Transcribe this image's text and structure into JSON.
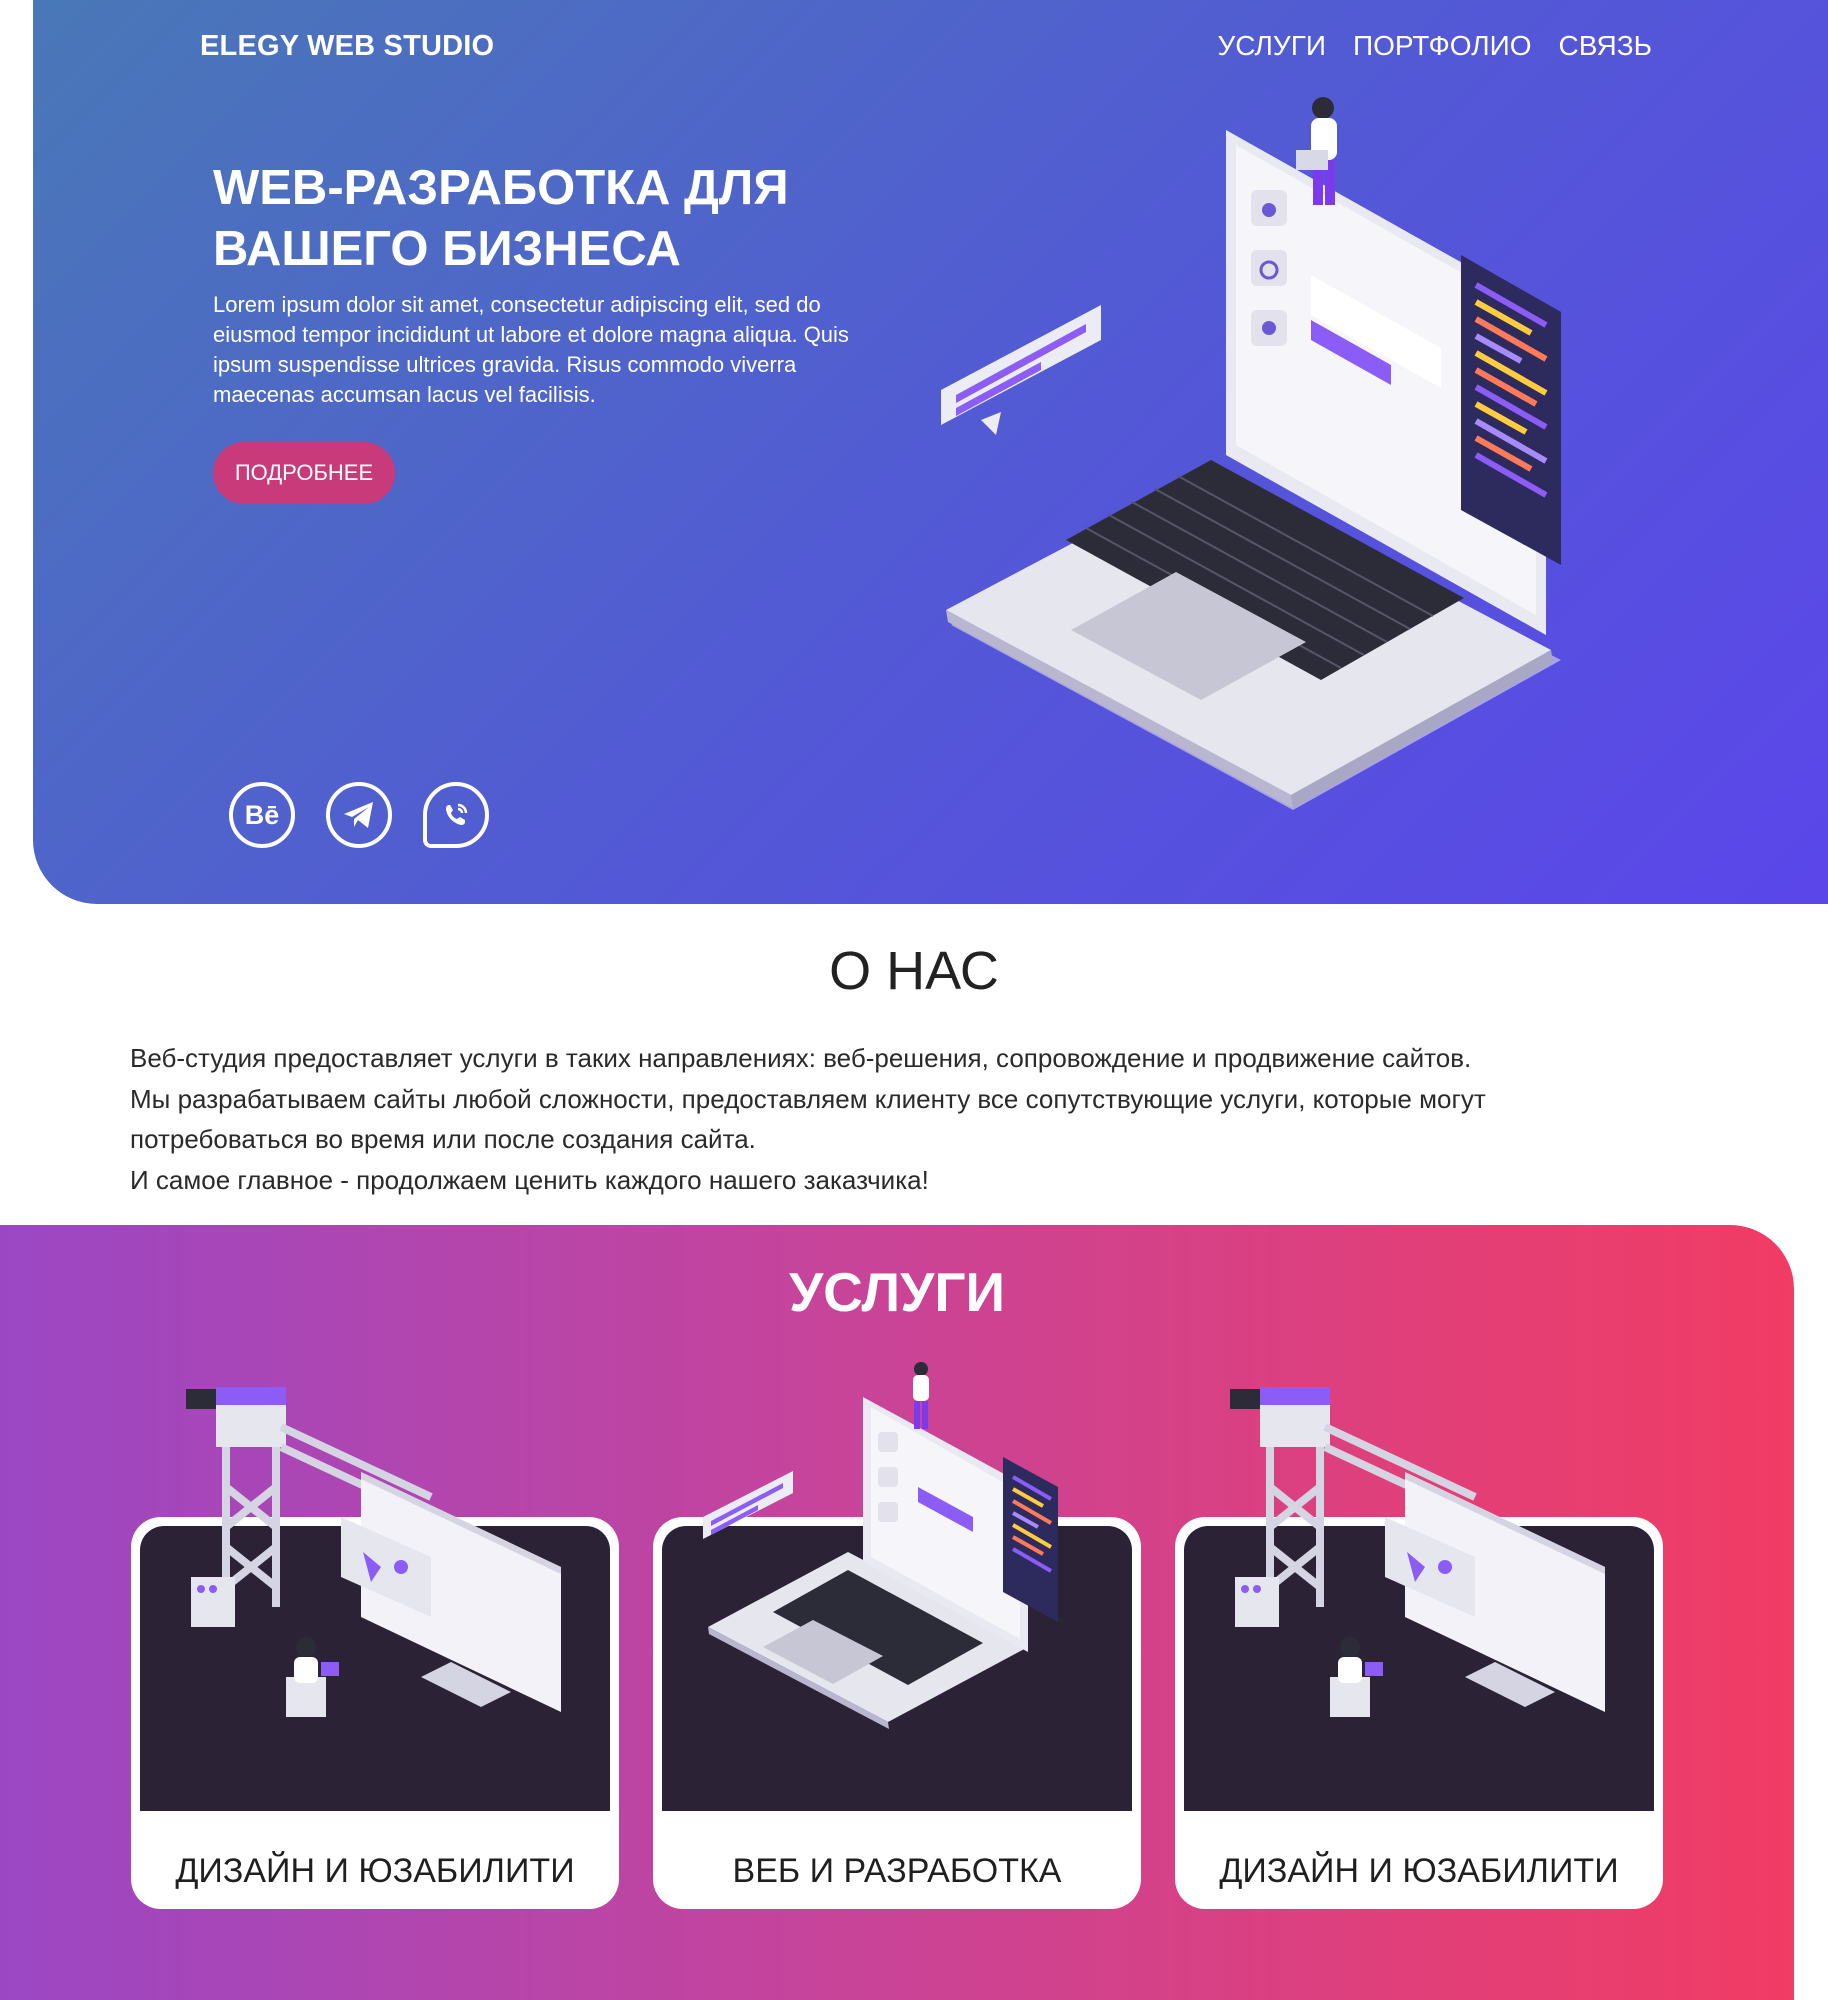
{
  "header": {
    "logo": "ELEGY WEB STUDIO",
    "nav": [
      "УСЛУГИ",
      "ПОРТФОЛИО",
      "СВЯЗЬ"
    ]
  },
  "hero": {
    "title": "WEB-РАЗРАБОТКА ДЛЯ ВАШЕГО БИЗНЕСА",
    "text": "Lorem ipsum dolor sit amet, consectetur adipiscing elit, sed do eiusmod tempor incididunt ut labore et dolore magna aliqua. Quis ipsum suspendisse ultrices gravida. Risus commodo viverra maecenas accumsan lacus vel facilisis.",
    "button": "ПОДРОБНЕЕ",
    "socials": [
      {
        "icon": "behance-icon",
        "text": "Bē"
      },
      {
        "icon": "telegram-icon"
      },
      {
        "icon": "viber-icon"
      }
    ]
  },
  "about": {
    "title": "О НАС",
    "paragraphs": [
      "Веб-студия предоставляет услуги в таких направлениях: веб-решения, сопровождение и продвижение сайтов.",
      "Мы разрабатываем сайты любой сложности, предоставляем клиенту все сопутствующие услуги, которые могут потребоваться во время или после создания сайта.",
      "И самое главное - продолжаем ценить каждого нашего заказчика!"
    ]
  },
  "services": {
    "title": "УСЛУГИ",
    "cards": [
      {
        "label": "ДИЗАЙН И ЮЗАБИЛИТИ"
      },
      {
        "label": "ВЕБ И РАЗРАБОТКА"
      },
      {
        "label": "ДИЗАЙН И ЮЗАБИЛИТИ"
      }
    ]
  },
  "colors": {
    "hero_gradient_start": "#4978b7",
    "hero_gradient_end": "#5b46ea",
    "button": "#c83a7a",
    "services_gradient_start": "#9b47c4",
    "services_gradient_end": "#f13c64",
    "card_dark": "#2b2236"
  }
}
